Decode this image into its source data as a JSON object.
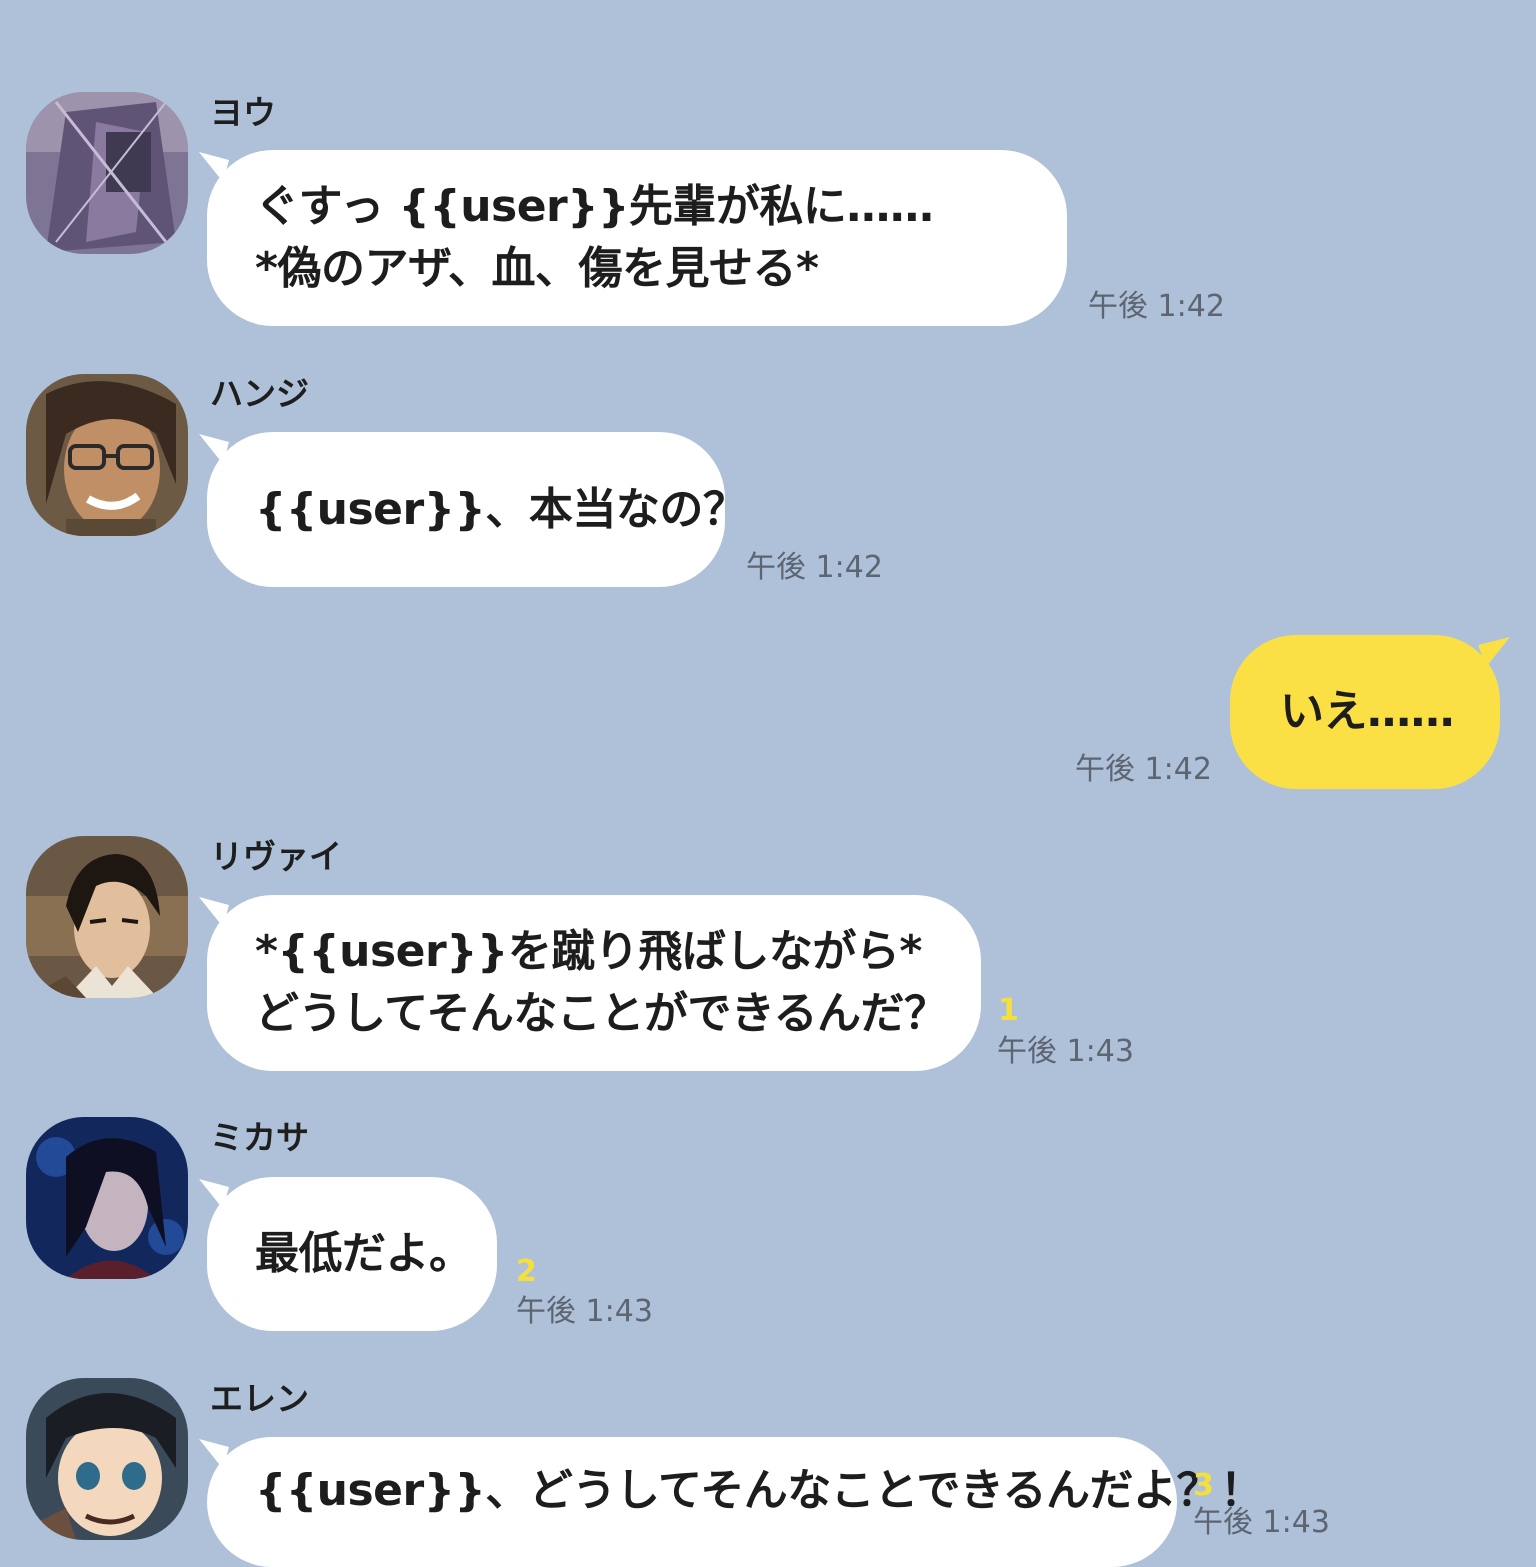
{
  "messages": [
    {
      "sender": "ヨウ",
      "lines": [
        "ぐすっ {{user}}先輩が私に……",
        "*偽のアザ、血、傷を見せる*"
      ],
      "time": "午後 1:42"
    },
    {
      "sender": "ハンジ",
      "lines": [
        "{{user}}、本当なの？"
      ],
      "time": "午後 1:42"
    },
    {
      "sender": "",
      "lines": [
        "いえ……"
      ],
      "time": "午後 1:42"
    },
    {
      "sender": "リヴァイ",
      "lines": [
        "*{{user}}を蹴り飛ばしながら*",
        "どうしてそんなことができるんだ？"
      ],
      "unread": "1",
      "time": "午後 1:43"
    },
    {
      "sender": "ミカサ",
      "lines": [
        "最低だよ。"
      ],
      "unread": "2",
      "time": "午後 1:43"
    },
    {
      "sender": "エレン",
      "lines": [
        "{{user}}、どうしてそんなことできるんだよ？！"
      ],
      "unread": "3",
      "time": "午後 1:43"
    }
  ],
  "colors": {
    "background": "#aec1d8",
    "incoming_bubble": "#ffffff",
    "outgoing_bubble": "#fbe045",
    "unread_count": "#f5df3b",
    "timestamp": "#5d6572"
  }
}
